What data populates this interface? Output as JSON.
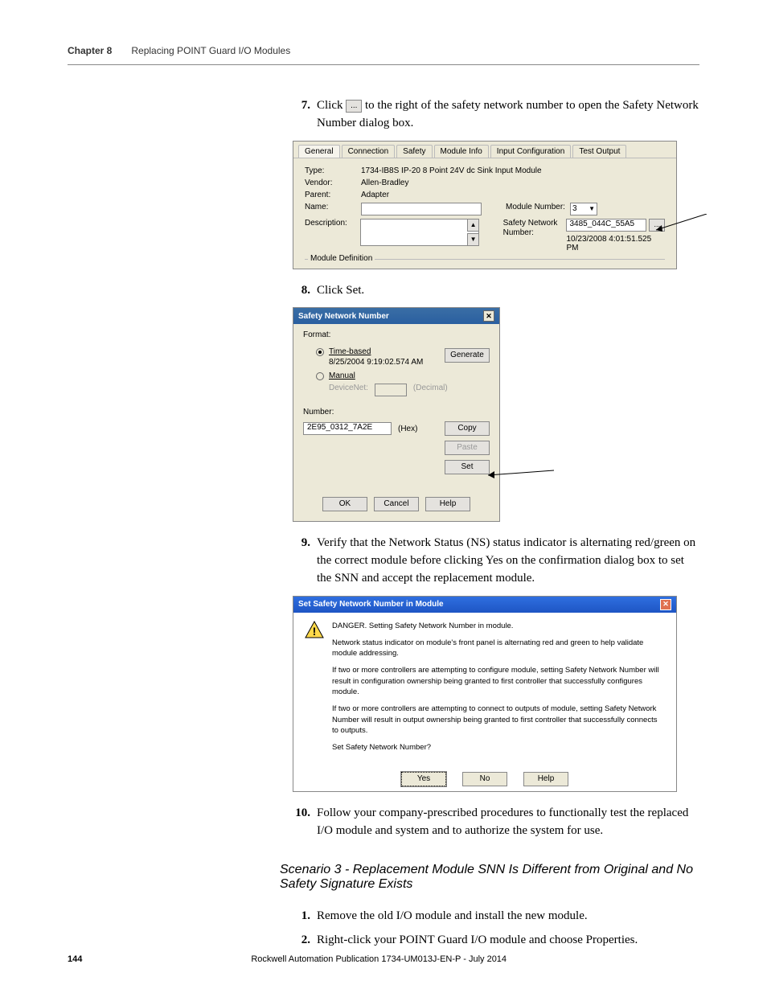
{
  "header": {
    "chapter": "Chapter 8",
    "title": "Replacing POINT Guard I/O Modules"
  },
  "steps": {
    "s7": {
      "num": "7.",
      "text_prefix": "Click ",
      "btn_label": "...",
      "text_suffix": " to the right of the safety network number to open the Safety Network Number dialog box."
    },
    "s8": {
      "num": "8.",
      "text": "Click Set."
    },
    "s9": {
      "num": "9.",
      "text": "Verify that the Network Status (NS) status indicator is alternating red/green on the correct module before clicking Yes on the confirmation dialog box to set the SNN and accept the replacement module."
    },
    "s10": {
      "num": "10.",
      "text": "Follow your company-prescribed procedures to functionally test the replaced I/O module and system and to authorize the system for use."
    },
    "s1b": {
      "num": "1.",
      "text": "Remove the old I/O module and install the new module."
    },
    "s2b": {
      "num": "2.",
      "text": "Right-click your POINT Guard I/O module and choose Properties."
    }
  },
  "scenario_heading": "Scenario 3 - Replacement Module SNN Is Different from Original and No Safety Signature Exists",
  "props_dialog": {
    "tabs": [
      "General",
      "Connection",
      "Safety",
      "Module Info",
      "Input Configuration",
      "Test Output"
    ],
    "labels": {
      "type": "Type:",
      "type_val": "1734-IB8S IP-20 8 Point 24V dc Sink Input Module",
      "vendor": "Vendor:",
      "vendor_val": "Allen-Bradley",
      "parent": "Parent:",
      "parent_val": "Adapter",
      "name": "Name:",
      "desc": "Description:",
      "module_num": "Module Number:",
      "module_num_val": "3",
      "snn": "Safety Network Number:",
      "snn_val": "3485_044C_55A5",
      "snn_time": "10/23/2008 4:01:51.525 PM",
      "more_btn": "...",
      "fieldset": "Module Definition"
    }
  },
  "snn_dialog": {
    "title": "Safety Network Number",
    "format_label": "Format:",
    "time_based": "Time-based",
    "time_val": "8/25/2004 9:19:02.574 AM",
    "manual": "Manual",
    "devicenet": "DeviceNet:",
    "decimal": "(Decimal)",
    "number_label": "Number:",
    "number_val": "2E95_0312_7A2E",
    "hex": "(Hex)",
    "buttons": {
      "generate": "Generate",
      "copy": "Copy",
      "paste": "Paste",
      "set": "Set",
      "ok": "OK",
      "cancel": "Cancel",
      "help": "Help"
    }
  },
  "confirm_dialog": {
    "title": "Set Safety Network Number in Module",
    "p1": "DANGER. Setting Safety Network Number in module.",
    "p2": "Network status indicator on module's front panel is alternating red and green to help validate module addressing.",
    "p3": "If two or more controllers are attempting to configure module, setting Safety Network Number will result in configuration ownership being granted to first controller that successfully configures module.",
    "p4": "If two or more controllers are attempting to connect to outputs of module, setting Safety Network Number will result in output ownership being granted to first controller that successfully connects to outputs.",
    "p5": "Set Safety Network Number?",
    "buttons": {
      "yes": "Yes",
      "no": "No",
      "help": "Help"
    }
  },
  "footer": {
    "page_num": "144",
    "pub": "Rockwell Automation Publication 1734-UM013J-EN-P - July 2014"
  }
}
